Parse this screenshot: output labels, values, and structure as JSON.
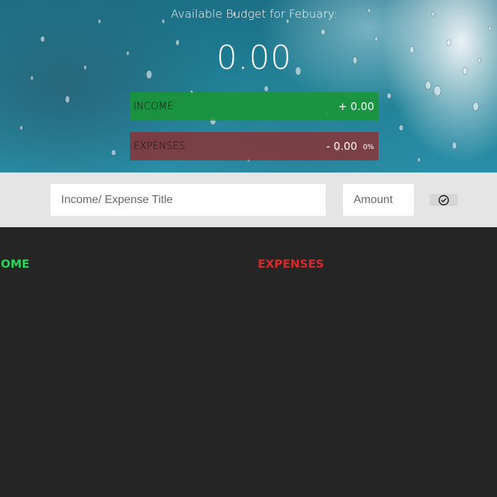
{
  "budget": {
    "title": "Available Budget for Febuary:",
    "value": "0.00"
  },
  "summary": {
    "income": {
      "label": "Income",
      "value": "+ 0.00"
    },
    "expenses": {
      "label": "Expenses",
      "value": "- 0.00",
      "percent": "0%"
    }
  },
  "add_form": {
    "title_placeholder": "Income/ Expense Title",
    "amount_placeholder": "Amount",
    "submit_icon": "check-circle-icon"
  },
  "lists": {
    "income_heading": "Income",
    "expenses_heading": "Expenses"
  },
  "colors": {
    "income": "#28B9B5",
    "income_heading": "#2fd35c",
    "expenses_heading": "#d42c2c",
    "page_background": "#252525",
    "input_bar": "#e5e5e5"
  }
}
